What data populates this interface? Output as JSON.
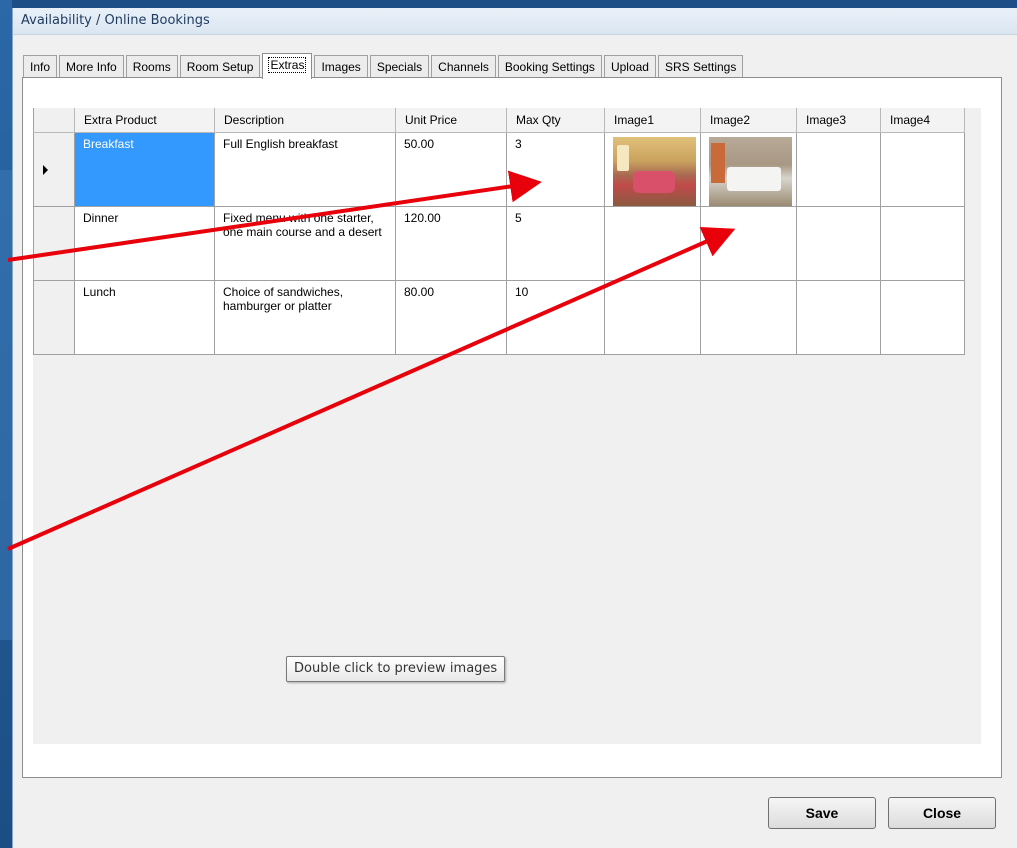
{
  "window": {
    "title": "Availability / Online Bookings"
  },
  "tabs": [
    {
      "label": "Info"
    },
    {
      "label": "More Info"
    },
    {
      "label": "Rooms"
    },
    {
      "label": "Room Setup"
    },
    {
      "label": "Extras",
      "active": true
    },
    {
      "label": "Images"
    },
    {
      "label": "Specials"
    },
    {
      "label": "Channels"
    },
    {
      "label": "Booking Settings"
    },
    {
      "label": "Upload"
    },
    {
      "label": "SRS Settings"
    }
  ],
  "grid": {
    "columns": [
      "Extra Product",
      "Description",
      "Unit Price",
      "Max Qty",
      "Image1",
      "Image2",
      "Image3",
      "Image4"
    ],
    "rows": [
      {
        "product": "Breakfast",
        "description": "Full English breakfast",
        "unit_price": "50.00",
        "max_qty": "3",
        "image1": "room-photo",
        "image2": "bedroom-photo"
      },
      {
        "product": "Dinner",
        "description": "Fixed menu with one starter, one main course and a desert",
        "unit_price": "120.00",
        "max_qty": "5"
      },
      {
        "product": "Lunch",
        "description": "Choice of sandwiches, hamburger or platter",
        "unit_price": "80.00",
        "max_qty": "10"
      }
    ]
  },
  "tooltip": "Double click to preview images",
  "buttons": {
    "save": "Save",
    "close": "Close"
  },
  "colors": {
    "selection": "#3399ff",
    "annotation_arrow": "#e8000b"
  }
}
